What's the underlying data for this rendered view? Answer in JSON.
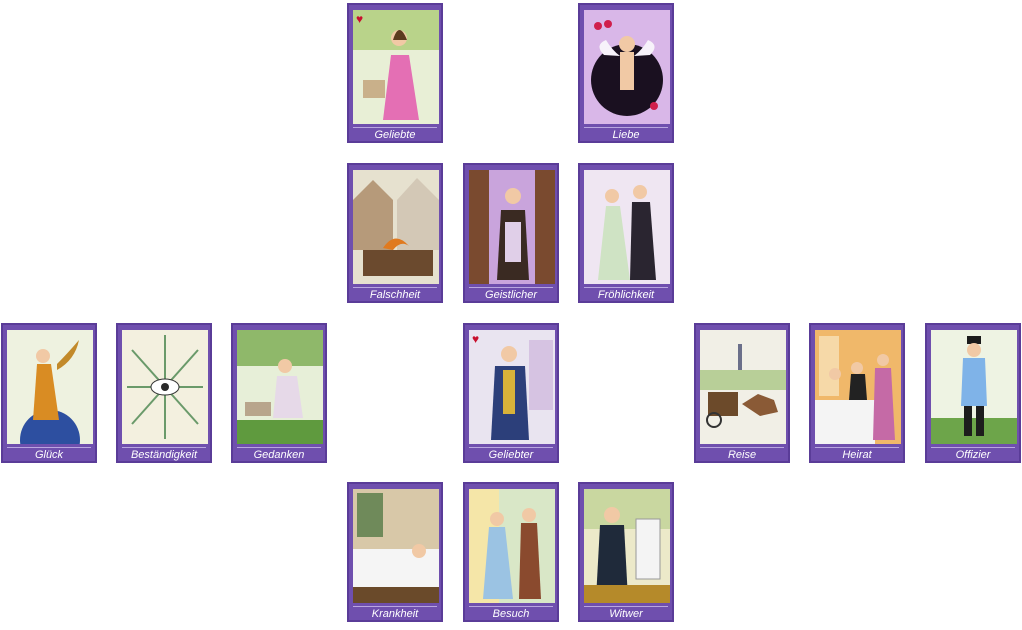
{
  "cards": {
    "geliebte": {
      "label": "Geliebte",
      "symbol": "♥"
    },
    "liebe": {
      "label": "Liebe"
    },
    "falschheit": {
      "label": "Falschheit"
    },
    "geistlicher": {
      "label": "Geistlicher"
    },
    "froehlichkeit": {
      "label": "Fröhlichkeit"
    },
    "glueck": {
      "label": "Glück"
    },
    "bestaendigkeit": {
      "label": "Beständigkeit"
    },
    "gedanken": {
      "label": "Gedanken"
    },
    "geliebter": {
      "label": "Geliebter",
      "symbol": "♥"
    },
    "reise": {
      "label": "Reise"
    },
    "heirat": {
      "label": "Heirat"
    },
    "offizier": {
      "label": "Offizier"
    },
    "krankheit": {
      "label": "Krankheit"
    },
    "besuch": {
      "label": "Besuch"
    },
    "witwer": {
      "label": "Witwer"
    }
  },
  "theme": {
    "frame_color": "#6f4fae",
    "heart_color": "#c8102e"
  }
}
